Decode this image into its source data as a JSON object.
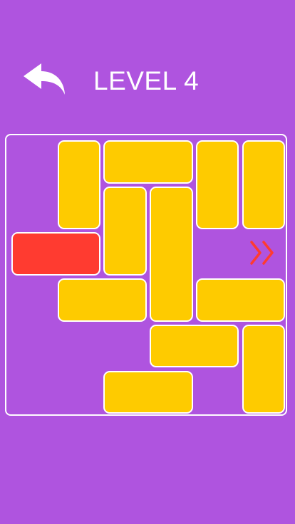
{
  "header": {
    "title": "LEVEL 4",
    "back_icon": "undo-arrow-icon"
  },
  "board": {
    "grid_size": 6,
    "exit_icon": "double-chevron-right-icon",
    "exit_row": 2,
    "colors": {
      "background": "#af54df",
      "block": "#fecb00",
      "target": "#ff3b30",
      "border": "#ffffff",
      "exit": "#ff3b30"
    },
    "blocks": [
      {
        "id": "v1",
        "row": 0,
        "col": 1,
        "w": 1,
        "h": 2,
        "target": false
      },
      {
        "id": "h1",
        "row": 0,
        "col": 2,
        "w": 2,
        "h": 1,
        "target": false
      },
      {
        "id": "v2",
        "row": 0,
        "col": 4,
        "w": 1,
        "h": 2,
        "target": false
      },
      {
        "id": "v3",
        "row": 0,
        "col": 5,
        "w": 1,
        "h": 2,
        "target": false
      },
      {
        "id": "v4",
        "row": 1,
        "col": 2,
        "w": 1,
        "h": 2,
        "target": false
      },
      {
        "id": "v5",
        "row": 1,
        "col": 3,
        "w": 1,
        "h": 3,
        "target": false
      },
      {
        "id": "red",
        "row": 2,
        "col": 0,
        "w": 2,
        "h": 1,
        "target": true
      },
      {
        "id": "h2",
        "row": 3,
        "col": 1,
        "w": 2,
        "h": 1,
        "target": false
      },
      {
        "id": "h3",
        "row": 3,
        "col": 4,
        "w": 2,
        "h": 1,
        "target": false
      },
      {
        "id": "h4",
        "row": 4,
        "col": 3,
        "w": 2,
        "h": 1,
        "target": false
      },
      {
        "id": "v6",
        "row": 4,
        "col": 5,
        "w": 1,
        "h": 2,
        "target": false
      },
      {
        "id": "h5",
        "row": 5,
        "col": 2,
        "w": 2,
        "h": 1,
        "target": false
      }
    ]
  }
}
